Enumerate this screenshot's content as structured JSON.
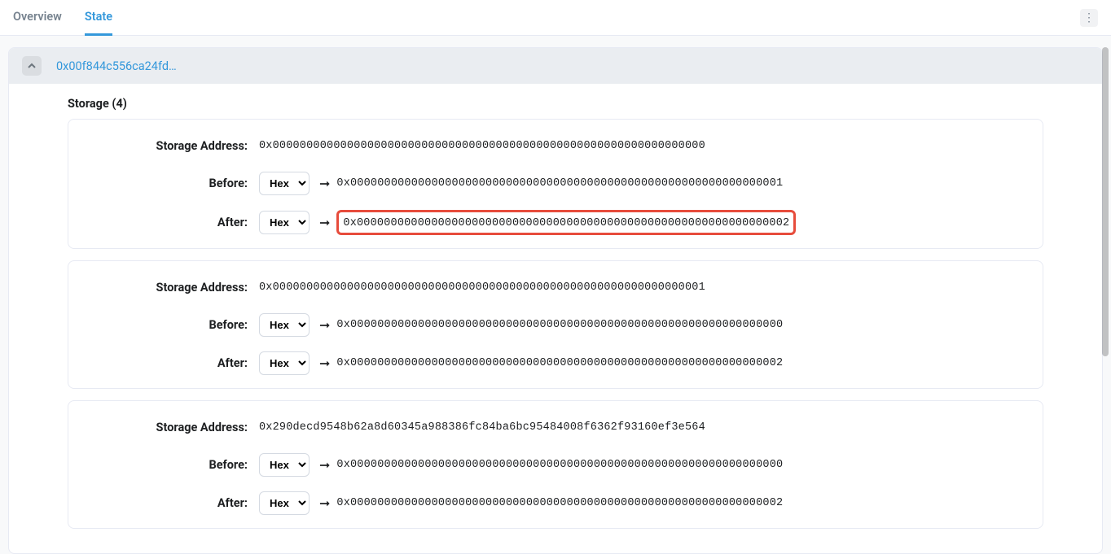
{
  "tabs": {
    "overview": "Overview",
    "state": "State"
  },
  "address_truncated": "0x00f844c556ca24fd…",
  "storage_title": "Storage (4)",
  "labels": {
    "storage_address": "Storage Address:",
    "before": "Before:",
    "after": "After:"
  },
  "select_value": "Hex",
  "storage_entries": [
    {
      "address": "0x0000000000000000000000000000000000000000000000000000000000000000",
      "before": "0x0000000000000000000000000000000000000000000000000000000000000001",
      "after": "0x0000000000000000000000000000000000000000000000000000000000000002",
      "after_highlighted": true
    },
    {
      "address": "0x0000000000000000000000000000000000000000000000000000000000000001",
      "before": "0x0000000000000000000000000000000000000000000000000000000000000000",
      "after": "0x0000000000000000000000000000000000000000000000000000000000000002",
      "after_highlighted": false
    },
    {
      "address": "0x290decd9548b62a8d60345a988386fc84ba6bc95484008f6362f93160ef3e564",
      "before": "0x0000000000000000000000000000000000000000000000000000000000000000",
      "after": "0x0000000000000000000000000000000000000000000000000000000000000002",
      "after_highlighted": false
    }
  ]
}
